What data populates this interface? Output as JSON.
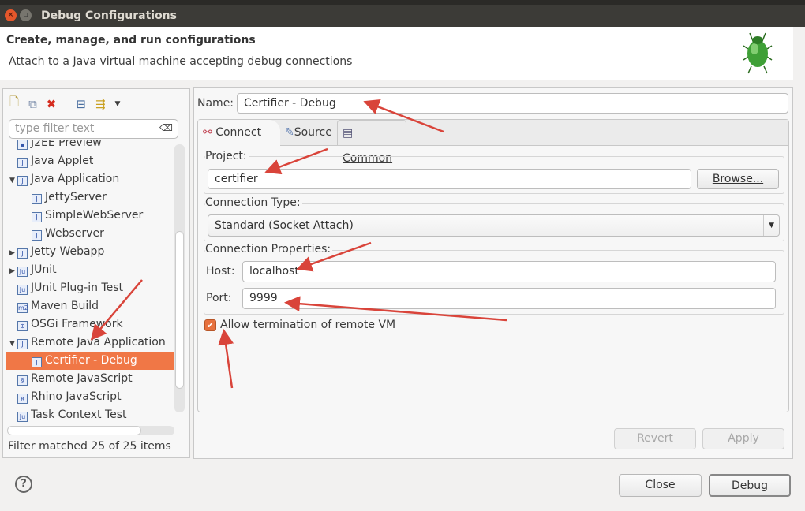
{
  "window": {
    "title": "Debug Configurations"
  },
  "header": {
    "title": "Create, manage, and run configurations",
    "subtitle": "Attach to a Java virtual machine accepting debug connections",
    "icon": "bug-icon"
  },
  "left": {
    "toolbar": [
      "new-config-icon",
      "duplicate-icon",
      "delete-icon",
      "collapse-all-icon",
      "filter-icon",
      "dropdown-icon"
    ],
    "filter_placeholder": "type filter text",
    "tree": [
      {
        "label": "J2EE Preview",
        "level": 0,
        "icon": "j2ee-icon"
      },
      {
        "label": "Java Applet",
        "level": 0,
        "icon": "applet-icon"
      },
      {
        "label": "Java Application",
        "level": 0,
        "icon": "java-app-icon",
        "expanded": true
      },
      {
        "label": "JettyServer",
        "level": 1,
        "icon": "java-app-icon"
      },
      {
        "label": "SimpleWebServer",
        "level": 1,
        "icon": "java-app-icon"
      },
      {
        "label": "Webserver",
        "level": 1,
        "icon": "java-app-icon"
      },
      {
        "label": "Jetty Webapp",
        "level": 0,
        "icon": "jetty-icon",
        "collapsed": true
      },
      {
        "label": "JUnit",
        "level": 0,
        "icon": "junit-icon",
        "collapsed": true
      },
      {
        "label": "JUnit Plug-in Test",
        "level": 0,
        "icon": "junit-plugin-icon"
      },
      {
        "label": "Maven Build",
        "level": 0,
        "icon": "maven-icon"
      },
      {
        "label": "OSGi Framework",
        "level": 0,
        "icon": "osgi-icon"
      },
      {
        "label": "Remote Java Application",
        "level": 0,
        "icon": "remote-java-icon",
        "expanded": true
      },
      {
        "label": "Certifier - Debug",
        "level": 1,
        "icon": "remote-java-icon",
        "selected": true
      },
      {
        "label": "Remote JavaScript",
        "level": 0,
        "icon": "remote-js-icon"
      },
      {
        "label": "Rhino JavaScript",
        "level": 0,
        "icon": "rhino-icon"
      },
      {
        "label": "Task Context Test",
        "level": 0,
        "icon": "task-test-icon"
      }
    ],
    "status": "Filter matched 25 of 25 items"
  },
  "right": {
    "name_label": "Name:",
    "name_value": "Certifier - Debug",
    "tabs": [
      {
        "label": "Connect",
        "active": true
      },
      {
        "label": "Source"
      },
      {
        "label": "Common"
      }
    ],
    "project_label": "Project:",
    "project_value": "certifier",
    "browse": "Browse...",
    "conn_type_label": "Connection Type:",
    "conn_type_value": "Standard (Socket Attach)",
    "conn_props_label": "Connection Properties:",
    "host_label": "Host:",
    "host_value": "localhost",
    "port_label": "Port:",
    "port_value": "9999",
    "allow_term_label": "Allow termination of remote VM",
    "allow_term_checked": true,
    "revert": "Revert",
    "apply": "Apply"
  },
  "footer": {
    "help": "?",
    "close": "Close",
    "debug": "Debug"
  },
  "colors": {
    "selection": "#f07746",
    "arrow": "#d9443a",
    "titlebar": "#3c3b37"
  }
}
